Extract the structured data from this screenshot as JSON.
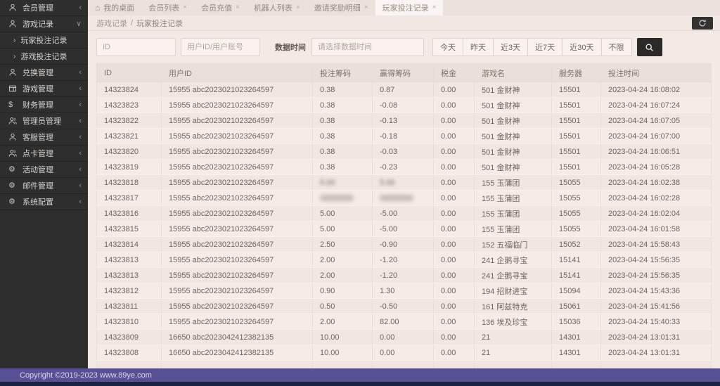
{
  "colors": {
    "page_bg": "#f4eae5",
    "sidebar_bg": "#2e2e2e",
    "active_tab_bg": "#faf5f2",
    "search_button_bg": "#2b2a29",
    "footer_bg": "#575094",
    "footer_strip": "#1a2340"
  },
  "sidebar": {
    "items": [
      {
        "icon": "user",
        "label": "会员管理",
        "chevron": "left"
      },
      {
        "icon": "user",
        "label": "游戏记录",
        "chevron": "down"
      },
      {
        "type": "sub",
        "label": "玩家投注记录"
      },
      {
        "type": "sub",
        "label": "游戏投注记录"
      },
      {
        "icon": "user",
        "label": "兑换管理",
        "chevron": "left"
      },
      {
        "icon": "window",
        "label": "游戏管理",
        "chevron": "left"
      },
      {
        "icon": "dollar",
        "label": "财务管理",
        "chevron": "left"
      },
      {
        "icon": "users",
        "label": "管理员管理",
        "chevron": "left"
      },
      {
        "icon": "user",
        "label": "客服管理",
        "chevron": "left"
      },
      {
        "icon": "users",
        "label": "点卡管理",
        "chevron": "left"
      },
      {
        "icon": "gear",
        "label": "活动管理",
        "chevron": "left"
      },
      {
        "icon": "gear",
        "label": "邮件管理",
        "chevron": "left"
      },
      {
        "icon": "gear",
        "label": "系统配置",
        "chevron": "left"
      }
    ]
  },
  "tabs": [
    {
      "label": "我的桌面",
      "icon": "home",
      "closable": false,
      "active": false
    },
    {
      "label": "会员列表",
      "closable": true,
      "active": false
    },
    {
      "label": "会员充值",
      "closable": true,
      "active": false
    },
    {
      "label": "机器人列表",
      "closable": true,
      "active": false
    },
    {
      "label": "邀请奖励明细",
      "closable": true,
      "active": false
    },
    {
      "label": "玩家投注记录",
      "closable": true,
      "active": true
    }
  ],
  "breadcrumb": {
    "parent": "游戏记录",
    "separator": "/",
    "current": "玩家投注记录"
  },
  "filters": {
    "id_placeholder": "ID",
    "user_placeholder": "用户ID/用户账号",
    "date_label": "数据时间",
    "date_placeholder": "请选择数据时间",
    "range_buttons": [
      "今天",
      "昨天",
      "近3天",
      "近7天",
      "近30天",
      "不限"
    ]
  },
  "table": {
    "columns": [
      "ID",
      "用户ID",
      "投注筹码",
      "赢得筹码",
      "税金",
      "游戏名",
      "服务器",
      "投注时间"
    ],
    "col_keys": [
      "id",
      "user",
      "bet",
      "win",
      "tax",
      "game",
      "server",
      "time"
    ],
    "rows": [
      {
        "id": "14323824",
        "user": "15955 abc2023021023264597",
        "bet": "0.38",
        "win": "0.87",
        "tax": "0.00",
        "game": "501 金财神",
        "server": "15501",
        "time": "2023-04-24 16:08:02"
      },
      {
        "id": "14323823",
        "user": "15955 abc2023021023264597",
        "bet": "0.38",
        "win": "-0.08",
        "tax": "0.00",
        "game": "501 金财神",
        "server": "15501",
        "time": "2023-04-24 16:07:24"
      },
      {
        "id": "14323822",
        "user": "15955 abc2023021023264597",
        "bet": "0.38",
        "win": "-0.13",
        "tax": "0.00",
        "game": "501 金财神",
        "server": "15501",
        "time": "2023-04-24 16:07:05"
      },
      {
        "id": "14323821",
        "user": "15955 abc2023021023264597",
        "bet": "0.38",
        "win": "-0.18",
        "tax": "0.00",
        "game": "501 金财神",
        "server": "15501",
        "time": "2023-04-24 16:07:00"
      },
      {
        "id": "14323820",
        "user": "15955 abc2023021023264597",
        "bet": "0.38",
        "win": "-0.03",
        "tax": "0.00",
        "game": "501 金财神",
        "server": "15501",
        "time": "2023-04-24 16:06:51"
      },
      {
        "id": "14323819",
        "user": "15955 abc2023021023264597",
        "bet": "0.38",
        "win": "-0.23",
        "tax": "0.00",
        "game": "501 金财神",
        "server": "15501",
        "time": "2023-04-24 16:05:28"
      },
      {
        "id": "14323818",
        "user": "15955 abc2023021023264597",
        "bet": "5.00",
        "win": "5.00",
        "tax": "0.00",
        "game": "155 玉蒲团",
        "server": "15055",
        "time": "2023-04-24 16:02:38",
        "blur": true
      },
      {
        "id": "14323817",
        "user": "15955 abc2023021023264597",
        "bet": "",
        "win": "",
        "tax": "0.00",
        "game": "155 玉蒲团",
        "server": "15055",
        "time": "2023-04-24 16:02:28",
        "blur": true
      },
      {
        "id": "14323816",
        "user": "15955 abc2023021023264597",
        "bet": "5.00",
        "win": "-5.00",
        "tax": "0.00",
        "game": "155 玉蒲团",
        "server": "15055",
        "time": "2023-04-24 16:02:04"
      },
      {
        "id": "14323815",
        "user": "15955 abc2023021023264597",
        "bet": "5.00",
        "win": "-5.00",
        "tax": "0.00",
        "game": "155 玉蒲团",
        "server": "15055",
        "time": "2023-04-24 16:01:58"
      },
      {
        "id": "14323814",
        "user": "15955 abc2023021023264597",
        "bet": "2.50",
        "win": "-0.90",
        "tax": "0.00",
        "game": "152 五福临门",
        "server": "15052",
        "time": "2023-04-24 15:58:43"
      },
      {
        "id": "14323813",
        "user": "15955 abc2023021023264597",
        "bet": "2.00",
        "win": "-1.20",
        "tax": "0.00",
        "game": "241 企鹅寻宝",
        "server": "15141",
        "time": "2023-04-24 15:56:35"
      },
      {
        "id": "14323813",
        "user": "15955 abc2023021023264597",
        "bet": "2.00",
        "win": "-1.20",
        "tax": "0.00",
        "game": "241 企鹅寻宝",
        "server": "15141",
        "time": "2023-04-24 15:56:35"
      },
      {
        "id": "14323812",
        "user": "15955 abc2023021023264597",
        "bet": "0.90",
        "win": "1.30",
        "tax": "0.00",
        "game": "194 招财进宝",
        "server": "15094",
        "time": "2023-04-24 15:43:36"
      },
      {
        "id": "14323811",
        "user": "15955 abc2023021023264597",
        "bet": "0.50",
        "win": "-0.50",
        "tax": "0.00",
        "game": "161 阿兹特克",
        "server": "15061",
        "time": "2023-04-24 15:41:56"
      },
      {
        "id": "14323810",
        "user": "15955 abc2023021023264597",
        "bet": "2.00",
        "win": "82.00",
        "tax": "0.00",
        "game": "136 埃及珍宝",
        "server": "15036",
        "time": "2023-04-24 15:40:33"
      },
      {
        "id": "14323809",
        "user": "16650 abc2023042412382135",
        "bet": "10.00",
        "win": "0.00",
        "tax": "0.00",
        "game": "21",
        "server": "14301",
        "time": "2023-04-24 13:01:31"
      },
      {
        "id": "14323808",
        "user": "16650 abc2023042412382135",
        "bet": "10.00",
        "win": "0.00",
        "tax": "0.00",
        "game": "21",
        "server": "14301",
        "time": "2023-04-24 13:01:31"
      }
    ]
  },
  "footer": {
    "copyright": "Copyright ©2019-2023 www.89ye.com"
  }
}
